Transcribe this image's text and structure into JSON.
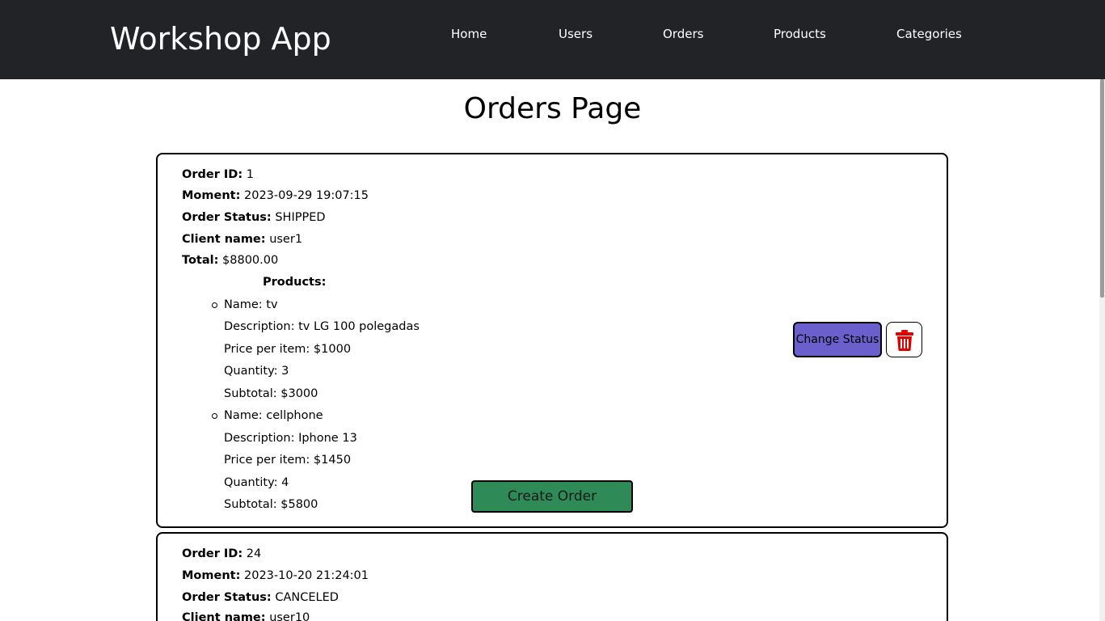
{
  "app": {
    "brand": "Workshop App"
  },
  "nav": {
    "items": [
      {
        "label": "Home"
      },
      {
        "label": "Users"
      },
      {
        "label": "Orders"
      },
      {
        "label": "Products"
      },
      {
        "label": "Categories"
      }
    ]
  },
  "page": {
    "title": "Orders Page"
  },
  "labels": {
    "order_id": "Order ID:",
    "moment": "Moment:",
    "order_status": "Order Status:",
    "client_name": "Client name:",
    "total": "Total:",
    "products": "Products:",
    "change_status": "Change Status",
    "create_order": "Create Order"
  },
  "orders": [
    {
      "id": "1",
      "moment": "2023-09-29 19:07:15",
      "status": "SHIPPED",
      "client": "user1",
      "total": "$8800.00",
      "products": [
        {
          "name": "Name: tv",
          "description": "Description: tv LG 100 polegadas",
          "price": "Price per item: $1000",
          "quantity": "Quantity: 3",
          "subtotal": "Subtotal: $3000"
        },
        {
          "name": "Name: cellphone",
          "description": "Description: Iphone 13",
          "price": "Price per item: $1450",
          "quantity": "Quantity: 4",
          "subtotal": "Subtotal: $5800"
        }
      ]
    },
    {
      "id": "24",
      "moment": "2023-10-20 21:24:01",
      "status": "CANCELED",
      "client": "user10"
    }
  ],
  "colors": {
    "navbar_bg": "#222327",
    "change_status_bg": "#6a5fcc",
    "create_order_bg": "#2e8b57",
    "delete_icon": "#e00000"
  },
  "icons": {
    "delete": "trash-icon"
  }
}
